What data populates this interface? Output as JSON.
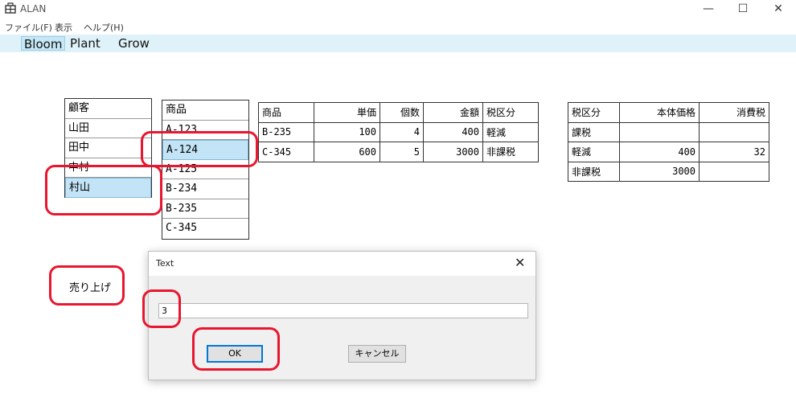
{
  "window": {
    "title": "ALAN",
    "minimize": "—",
    "maximize": "☐",
    "close": "✕"
  },
  "menu": [
    "ファイル(F)",
    "表示",
    "ヘルプ(H)"
  ],
  "tabs": [
    "Bloom",
    "Plant",
    "Grow"
  ],
  "customers": {
    "header": "顧客",
    "items": [
      "山田",
      "田中",
      "中村",
      "村山"
    ],
    "selected_index": 3
  },
  "products": {
    "header": "商品",
    "items": [
      "A-123",
      "A-124",
      "A-125",
      "B-234",
      "B-235",
      "C-345"
    ],
    "selected_index": 1
  },
  "order_table": {
    "headers": [
      "商品",
      "単価",
      "個数",
      "金額",
      "税区分"
    ],
    "rows": [
      [
        "B-235",
        "100",
        "4",
        "400",
        "軽減"
      ],
      [
        "C-345",
        "600",
        "5",
        "3000",
        "非課税"
      ]
    ]
  },
  "tax_table": {
    "headers": [
      "税区分",
      "本体価格",
      "消費税"
    ],
    "rows": [
      [
        "課税",
        "",
        ""
      ],
      [
        "軽減",
        "400",
        "32"
      ],
      [
        "非課税",
        "3000",
        ""
      ]
    ]
  },
  "sales_label": "売り上げ",
  "dialog": {
    "title": "Text",
    "close": "✕",
    "input_value": "3",
    "ok_label": "OK",
    "cancel_label": "キャンセル"
  },
  "colors": {
    "annotation": "#e8162f",
    "selection": "#c3e4f6",
    "tab_bar": "#dff2f9"
  }
}
